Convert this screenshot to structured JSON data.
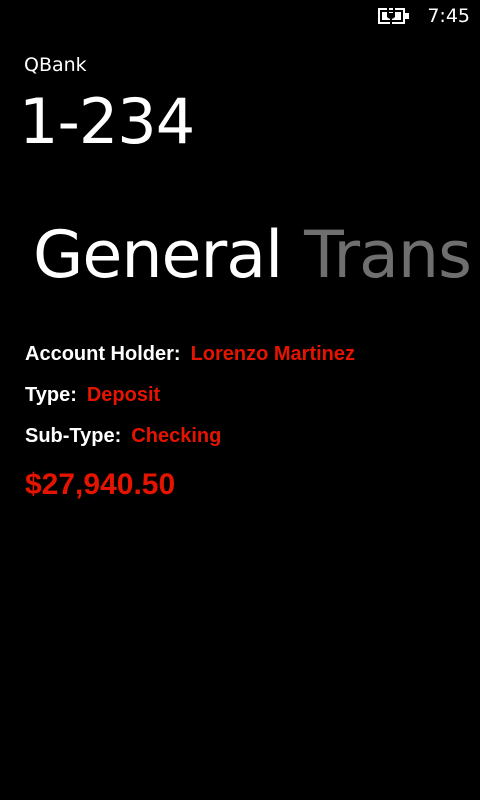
{
  "status_bar": {
    "battery_icon": "battery-charging-icon",
    "time": "7:45"
  },
  "app": {
    "title": "QBank",
    "page_title": "1-234"
  },
  "pivot": {
    "items": [
      {
        "label": "General",
        "active": true
      },
      {
        "label": "Transa",
        "active": false
      }
    ]
  },
  "details": {
    "account_holder_label": "Account Holder:",
    "account_holder_value": "Lorenzo Martinez",
    "type_label": "Type:",
    "type_value": "Deposit",
    "subtype_label": "Sub-Type:",
    "subtype_value": "Checking",
    "amount": "$27,940.50"
  },
  "colors": {
    "background": "#000000",
    "text": "#ffffff",
    "accent": "#e51400",
    "inactive_pivot": "#6f6f6f"
  }
}
